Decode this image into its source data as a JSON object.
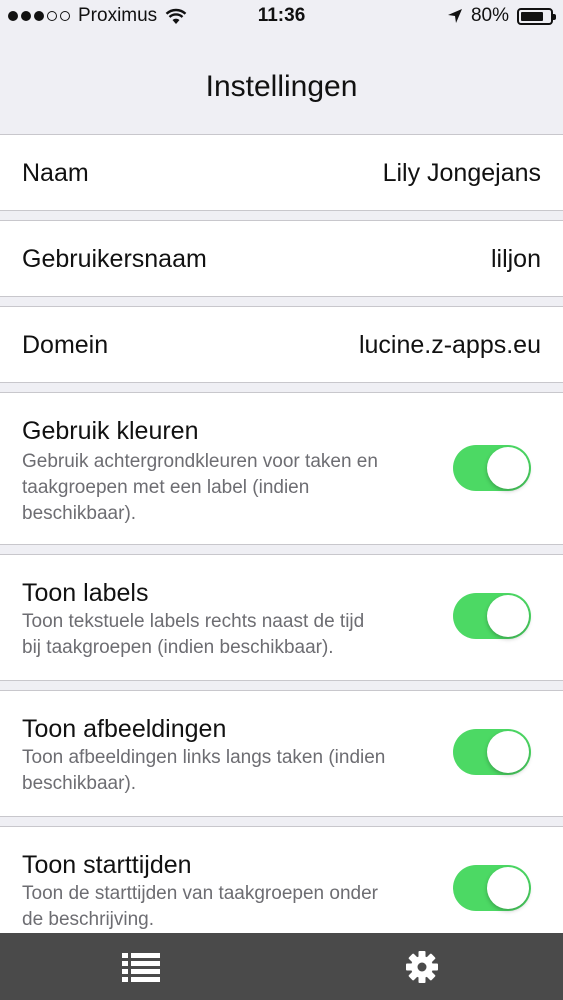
{
  "status_bar": {
    "signal_dots_filled": 3,
    "signal_dots_total": 5,
    "carrier": "Proximus",
    "time": "11:36",
    "battery_percent_label": "80%",
    "battery_level": 0.8
  },
  "nav": {
    "title": "Instellingen"
  },
  "account": [
    {
      "label": "Naam",
      "value": "Lily Jongejans"
    },
    {
      "label": "Gebruikersnaam",
      "value": "liljon"
    },
    {
      "label": "Domein",
      "value": "lucine.z-apps.eu"
    }
  ],
  "toggles": [
    {
      "label": "Gebruik kleuren",
      "desc_lines": [
        "Gebruik achtergrondkleuren voor taken en",
        "taakgroepen met een label (indien",
        "beschikbaar)."
      ],
      "on": true
    },
    {
      "label": "Toon labels",
      "desc_lines": [
        "Toon tekstuele labels rechts naast de tijd",
        "bij taakgroepen (indien beschikbaar)."
      ],
      "on": true
    },
    {
      "label": "Toon afbeeldingen",
      "desc_lines": [
        "Toon afbeeldingen links langs taken (indien",
        "beschikbaar)."
      ],
      "on": true
    },
    {
      "label": "Toon starttijden",
      "desc_lines": [
        "Toon de starttijden van taakgroepen onder",
        "de beschrijving."
      ],
      "on": true
    }
  ],
  "tab_bar": {
    "tabs": [
      {
        "name": "list",
        "icon": "list-icon",
        "selected": false
      },
      {
        "name": "settings",
        "icon": "gear-icon",
        "selected": true
      }
    ]
  },
  "colors": {
    "accent_green": "#4cd964",
    "tab_bar_bg": "#4a4a4a",
    "grouped_bg": "#efeff4"
  }
}
